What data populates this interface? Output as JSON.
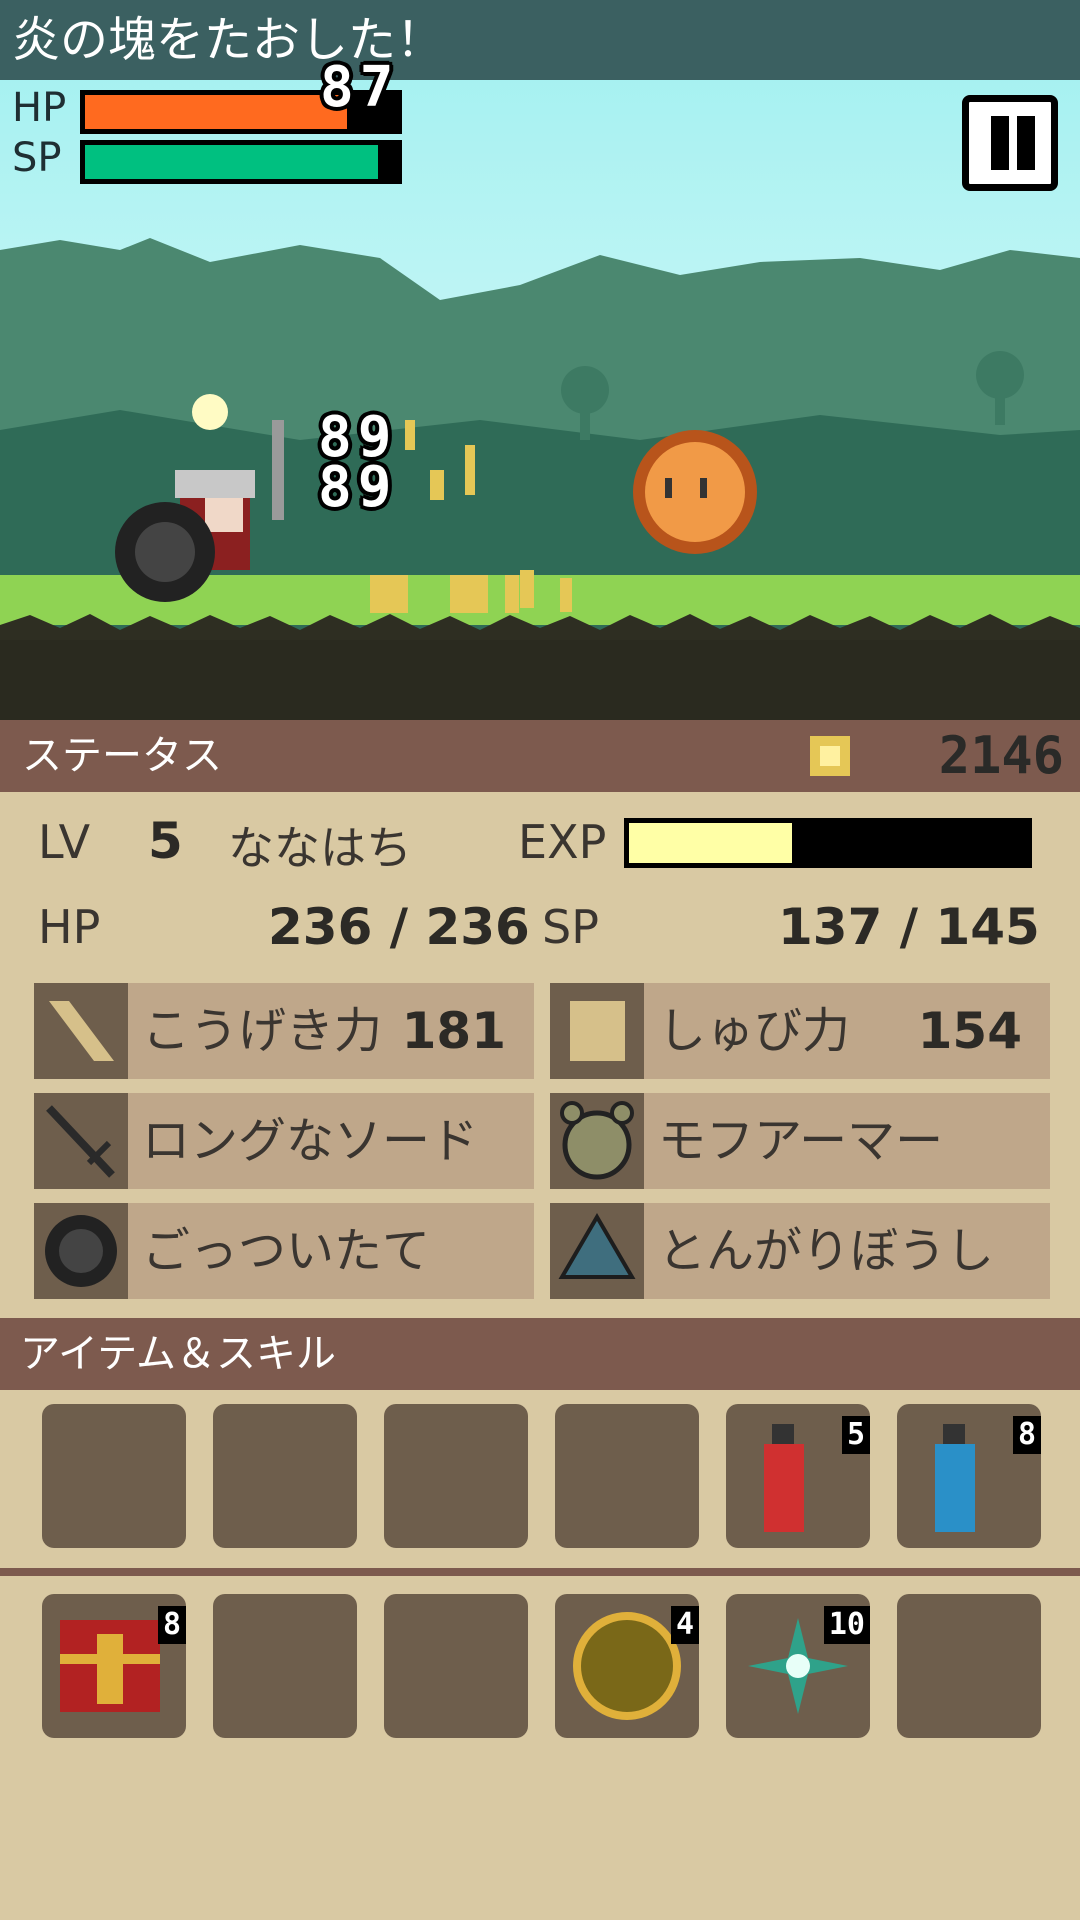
{
  "battle": {
    "message": "炎の塊をたおした！",
    "hp_label": "HP",
    "sp_label": "SP",
    "hp_ratio": 0.84,
    "sp_ratio": 0.94,
    "damage_popups": [
      "87",
      "89",
      "89"
    ],
    "pause": "pause-icon"
  },
  "status": {
    "heading": "ステータス",
    "gold": "2146",
    "lv_label": "LV",
    "lv": "5",
    "name": "ななはち",
    "exp_label": "EXP",
    "exp_ratio": 0.41,
    "hp_label": "HP",
    "hp_value": "236 / 236",
    "sp_label": "SP",
    "sp_value": "137 / 145",
    "attack_label": "こうげき力",
    "attack_value": "181",
    "defense_label": "しゅび力",
    "defense_value": "154",
    "weapon": "ロングなソード",
    "armor": "モフアーマー",
    "shield": "ごっついたて",
    "helmet": "とんがりぼうし"
  },
  "items": {
    "heading": "アイテム＆スキル",
    "row1_counts": [
      "5",
      "8"
    ],
    "row2_counts": [
      "8",
      "4",
      "10"
    ]
  },
  "colors": {
    "hp": "#ff6a1f",
    "sp": "#00c080",
    "header_bg": "#7d5a4e",
    "panel_bg": "#d9c9a3",
    "slot_bg": "#6e5e4c"
  }
}
